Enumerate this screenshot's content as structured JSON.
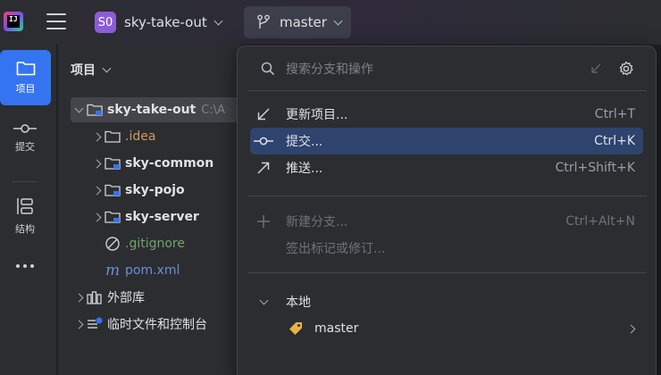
{
  "app": {
    "logo_text": "IJ",
    "project_badge": "S0",
    "project_name": "sky-take-out",
    "branch_name": "master"
  },
  "colors": {
    "accent": "#3574f0",
    "selection": "#2e436e",
    "project_badge_bg": "#8e5bd6",
    "folder_orange": "#d39a5a",
    "gitignore_green": "#72a36b",
    "pom_blue": "#6b8fdc"
  },
  "toolstrip": {
    "items": [
      {
        "label": "项目",
        "icon": "folder-icon",
        "active": true
      },
      {
        "label": "提交",
        "icon": "commit-icon",
        "active": false
      },
      {
        "label": "结构",
        "icon": "structure-icon",
        "active": false
      }
    ],
    "more_icon": "more-horizontal-icon"
  },
  "panel": {
    "title": "项目",
    "tree": [
      {
        "label": "sky-take-out",
        "suffix": "C:\\A",
        "bold": true,
        "expanded": true,
        "selected": true,
        "icon": "module-folder-icon"
      },
      {
        "label": ".idea",
        "color": "#d39a5a",
        "icon": "folder-icon"
      },
      {
        "label": "sky-common",
        "bold": true,
        "icon": "module-folder-icon"
      },
      {
        "label": "sky-pojo",
        "bold": true,
        "icon": "module-folder-icon"
      },
      {
        "label": "sky-server",
        "bold": true,
        "icon": "module-folder-icon"
      },
      {
        "label": ".gitignore",
        "color": "#72a36b",
        "icon": "gitignore-icon"
      },
      {
        "label": "pom.xml",
        "color": "#6b8fdc",
        "icon": "maven-icon"
      },
      {
        "label": "外部库",
        "icon": "library-icon"
      },
      {
        "label": "临时文件和控制台",
        "icon": "scratches-icon"
      }
    ]
  },
  "popup": {
    "search_placeholder": "搜索分支和操作",
    "actions": [
      {
        "label": "更新项目...",
        "shortcut": "Ctrl+T",
        "icon": "update-arrow-icon",
        "selected": false,
        "disabled": false
      },
      {
        "label": "提交...",
        "shortcut": "Ctrl+K",
        "icon": "commit-icon",
        "selected": true,
        "disabled": false
      },
      {
        "label": "推送...",
        "shortcut": "Ctrl+Shift+K",
        "icon": "push-arrow-icon",
        "selected": false,
        "disabled": false
      }
    ],
    "branch_actions": [
      {
        "label": "新建分支...",
        "shortcut": "Ctrl+Alt+N",
        "icon": "plus-icon",
        "disabled": true
      },
      {
        "label": "签出标记或修订...",
        "shortcut": "",
        "icon": "",
        "disabled": true
      }
    ],
    "local_group": {
      "label": "本地",
      "branches": [
        {
          "name": "master",
          "icon": "tag-icon"
        }
      ]
    }
  }
}
